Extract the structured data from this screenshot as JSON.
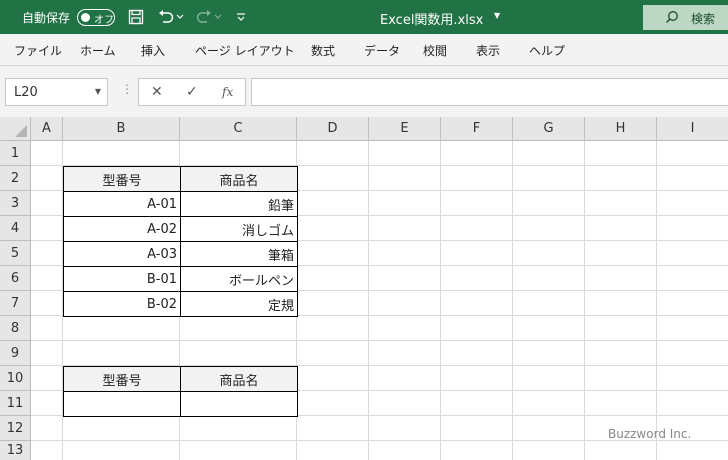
{
  "titlebar": {
    "autosave_label": "自動保存",
    "autosave_state": "オフ",
    "title": "Excel関数用.xlsx",
    "search_label": "検索",
    "accent_color": "#217346"
  },
  "ribbon": {
    "tabs": [
      "ファイル",
      "ホーム",
      "挿入",
      "ページ レイアウト",
      "数式",
      "データ",
      "校閲",
      "表示",
      "ヘルプ"
    ]
  },
  "formula_bar": {
    "name_box": "L20",
    "fx_label": "fx",
    "formula": ""
  },
  "sheet": {
    "columns": [
      "A",
      "B",
      "C",
      "D",
      "E",
      "F",
      "G",
      "H",
      "I"
    ],
    "rows": [
      "1",
      "2",
      "3",
      "4",
      "5",
      "6",
      "7",
      "8",
      "9",
      "10",
      "11",
      "12",
      "13"
    ],
    "table1": {
      "headers": [
        "型番号",
        "商品名"
      ],
      "rows": [
        [
          "A-01",
          "鉛筆"
        ],
        [
          "A-02",
          "消しゴム"
        ],
        [
          "A-03",
          "筆箱"
        ],
        [
          "B-01",
          "ボールペン"
        ],
        [
          "B-02",
          "定規"
        ]
      ]
    },
    "table2": {
      "headers": [
        "型番号",
        "商品名"
      ],
      "rows": [
        [
          "",
          ""
        ]
      ]
    }
  },
  "watermark": "Buzzword Inc."
}
